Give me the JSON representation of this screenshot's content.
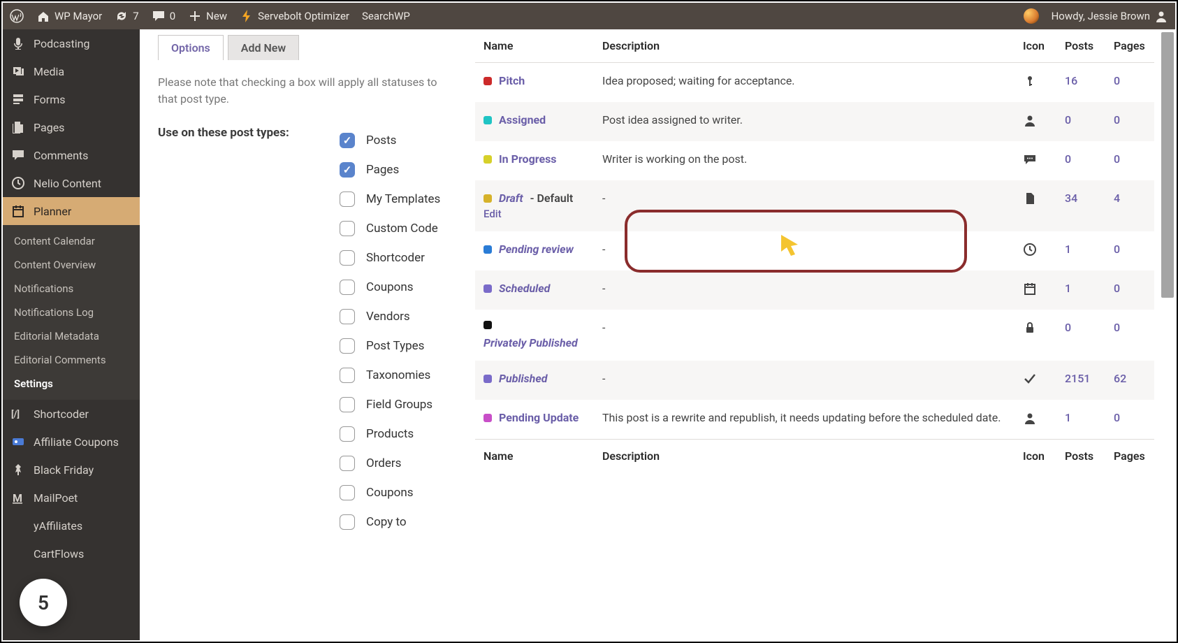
{
  "adminbar": {
    "site_name": "WP Mayor",
    "updates": "7",
    "comments": "0",
    "new": "New",
    "servebolt": "Servebolt Optimizer",
    "searchwp": "SearchWP",
    "howdy": "Howdy, Jessie Brown"
  },
  "sidebar": {
    "items": [
      {
        "label": "Podcasting",
        "icon": "mic"
      },
      {
        "label": "Media",
        "icon": "media"
      },
      {
        "label": "Forms",
        "icon": "forms"
      },
      {
        "label": "Pages",
        "icon": "pages"
      },
      {
        "label": "Comments",
        "icon": "comments"
      },
      {
        "label": "Nelio Content",
        "icon": "clock"
      },
      {
        "label": "Planner",
        "icon": "calendar",
        "active": true
      },
      {
        "label": "Shortcoder",
        "icon": "code"
      },
      {
        "label": "Affiliate Coupons",
        "icon": "coupons"
      },
      {
        "label": "Black Friday",
        "icon": "pin"
      },
      {
        "label": "MailPoet",
        "icon": "mailpoet"
      },
      {
        "label": "yAffiliates",
        "icon": "blank"
      },
      {
        "label": "CartFlows",
        "icon": "blank"
      }
    ],
    "submenu": [
      "Content Calendar",
      "Content Overview",
      "Notifications",
      "Notifications Log",
      "Editorial Metadata",
      "Editorial Comments",
      "Settings"
    ],
    "submenu_current": "Settings"
  },
  "tabs": {
    "options": "Options",
    "add_new": "Add New"
  },
  "note": "Please note that checking a box will apply all statuses to that post type.",
  "pt_label": "Use on these post types:",
  "post_types": [
    {
      "label": "Posts",
      "checked": true
    },
    {
      "label": "Pages",
      "checked": true
    },
    {
      "label": "My Templates",
      "checked": false
    },
    {
      "label": "Custom Code",
      "checked": false
    },
    {
      "label": "Shortcoder",
      "checked": false
    },
    {
      "label": "Coupons",
      "checked": false
    },
    {
      "label": "Vendors",
      "checked": false
    },
    {
      "label": "Post Types",
      "checked": false
    },
    {
      "label": "Taxonomies",
      "checked": false
    },
    {
      "label": "Field Groups",
      "checked": false
    },
    {
      "label": "Products",
      "checked": false
    },
    {
      "label": "Orders",
      "checked": false
    },
    {
      "label": "Coupons",
      "checked": false
    },
    {
      "label": "Copy to",
      "checked": false
    }
  ],
  "table": {
    "headers": {
      "name": "Name",
      "desc": "Description",
      "icon": "Icon",
      "posts": "Posts",
      "pages": "Pages"
    },
    "rows": [
      {
        "color": "#cc2a2a",
        "name": "Pitch",
        "italic": false,
        "default": false,
        "desc": "Idea proposed; waiting for acceptance.",
        "icon": "key",
        "posts": "16",
        "pages": "0"
      },
      {
        "color": "#1fc4c4",
        "name": "Assigned",
        "italic": false,
        "default": false,
        "desc": "Post idea assigned to writer.",
        "icon": "user",
        "posts": "0",
        "pages": "0"
      },
      {
        "color": "#d6d02a",
        "name": "In Progress",
        "italic": false,
        "default": false,
        "desc": "Writer is working on the post.",
        "icon": "chat",
        "posts": "0",
        "pages": "0"
      },
      {
        "color": "#d6b22a",
        "name": "Draft",
        "italic": true,
        "default": true,
        "desc": "-",
        "icon": "file",
        "posts": "34",
        "pages": "4",
        "edit": "Edit"
      },
      {
        "color": "#2a7cd6",
        "name": "Pending review",
        "italic": true,
        "default": false,
        "desc": "-",
        "icon": "clock",
        "posts": "1",
        "pages": "0"
      },
      {
        "color": "#7a6bc9",
        "name": "Scheduled",
        "italic": true,
        "default": false,
        "desc": "-",
        "icon": "calendar",
        "posts": "1",
        "pages": "0"
      },
      {
        "color": "#111",
        "name": "Privately Published",
        "italic": true,
        "default": false,
        "desc": "-",
        "icon": "lock",
        "posts": "0",
        "pages": "0"
      },
      {
        "color": "#7a6bc9",
        "name": "Published",
        "italic": true,
        "default": false,
        "desc": "-",
        "icon": "check",
        "posts": "2151",
        "pages": "62"
      },
      {
        "color": "#c84fc8",
        "name": "Pending Update",
        "italic": false,
        "default": false,
        "desc": "This post is a rewrite and republish, it needs updating before the scheduled date.",
        "icon": "user",
        "posts": "1",
        "pages": "0"
      }
    ],
    "default_suffix": " - Default"
  },
  "badge": "5"
}
